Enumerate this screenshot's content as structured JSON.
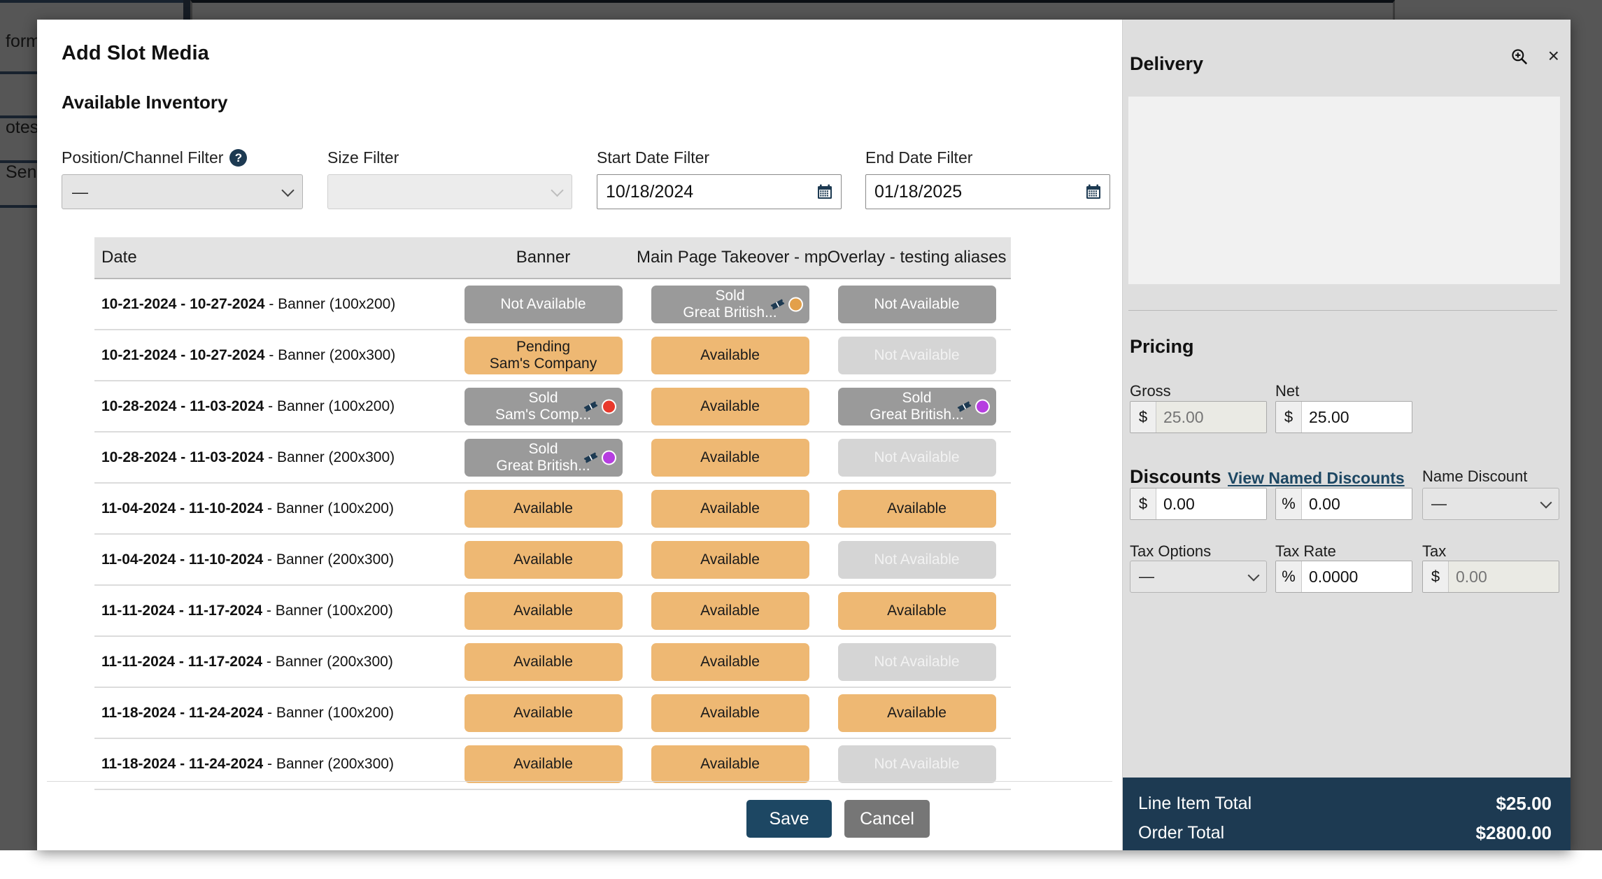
{
  "background": {
    "left_items": [
      "form",
      "otes",
      "Send"
    ]
  },
  "modal": {
    "title": "Add Slot Media",
    "section_title": "Available Inventory"
  },
  "filters": {
    "position_channel": {
      "label": "Position/Channel Filter",
      "help_icon": "question-mark-icon",
      "value": "—"
    },
    "size": {
      "label": "Size Filter",
      "value": ""
    },
    "start_date": {
      "label": "Start Date Filter",
      "value": "10/18/2024",
      "icon": "calendar-icon"
    },
    "end_date": {
      "label": "End Date Filter",
      "value": "01/18/2025",
      "icon": "calendar-icon"
    }
  },
  "inventory_table": {
    "columns": [
      "Date",
      "Banner",
      "Main Page Takeover - mp",
      "Overlay - testing aliases"
    ],
    "rows": [
      {
        "date_range": "10-21-2024 - 10-27-2024",
        "suffix": " - Banner (100x200)",
        "cells": [
          {
            "state": "notavail",
            "line1": "Not Available",
            "line2": ""
          },
          {
            "state": "sold",
            "line1": "Sold",
            "line2": "Great British...",
            "tag": true,
            "dot": "#e3a04a"
          },
          {
            "state": "notavail",
            "line1": "Not Available",
            "line2": ""
          }
        ]
      },
      {
        "date_range": "10-21-2024 - 10-27-2024",
        "suffix": " - Banner (200x300)",
        "cells": [
          {
            "state": "pending",
            "line1": "Pending",
            "line2": "Sam's Company"
          },
          {
            "state": "available",
            "line1": "Available",
            "line2": ""
          },
          {
            "state": "notavail-lt",
            "line1": "Not Available",
            "line2": ""
          }
        ]
      },
      {
        "date_range": "10-28-2024 - 11-03-2024",
        "suffix": " - Banner (100x200)",
        "cells": [
          {
            "state": "sold",
            "line1": "Sold",
            "line2": "Sam's Comp...",
            "tag": true,
            "dot": "#e8392c"
          },
          {
            "state": "available",
            "line1": "Available",
            "line2": ""
          },
          {
            "state": "sold",
            "line1": "Sold",
            "line2": "Great British...",
            "tag": true,
            "dot": "#b63ee0"
          }
        ]
      },
      {
        "date_range": "10-28-2024 - 11-03-2024",
        "suffix": " - Banner (200x300)",
        "cells": [
          {
            "state": "sold",
            "line1": "Sold",
            "line2": "Great British...",
            "tag": true,
            "dot": "#b63ee0"
          },
          {
            "state": "available",
            "line1": "Available",
            "line2": ""
          },
          {
            "state": "notavail-lt",
            "line1": "Not Available",
            "line2": ""
          }
        ]
      },
      {
        "date_range": "11-04-2024 - 11-10-2024",
        "suffix": " - Banner (100x200)",
        "cells": [
          {
            "state": "available",
            "line1": "Available",
            "line2": ""
          },
          {
            "state": "available",
            "line1": "Available",
            "line2": ""
          },
          {
            "state": "available",
            "line1": "Available",
            "line2": ""
          }
        ]
      },
      {
        "date_range": "11-04-2024 - 11-10-2024",
        "suffix": " - Banner (200x300)",
        "cells": [
          {
            "state": "available",
            "line1": "Available",
            "line2": ""
          },
          {
            "state": "available",
            "line1": "Available",
            "line2": ""
          },
          {
            "state": "notavail-lt",
            "line1": "Not Available",
            "line2": ""
          }
        ]
      },
      {
        "date_range": "11-11-2024 - 11-17-2024",
        "suffix": " - Banner (100x200)",
        "cells": [
          {
            "state": "available",
            "line1": "Available",
            "line2": ""
          },
          {
            "state": "available",
            "line1": "Available",
            "line2": ""
          },
          {
            "state": "available",
            "line1": "Available",
            "line2": ""
          }
        ]
      },
      {
        "date_range": "11-11-2024 - 11-17-2024",
        "suffix": " - Banner (200x300)",
        "cells": [
          {
            "state": "available",
            "line1": "Available",
            "line2": ""
          },
          {
            "state": "available",
            "line1": "Available",
            "line2": ""
          },
          {
            "state": "notavail-lt",
            "line1": "Not Available",
            "line2": ""
          }
        ]
      },
      {
        "date_range": "11-18-2024 - 11-24-2024",
        "suffix": " - Banner (100x200)",
        "cells": [
          {
            "state": "available",
            "line1": "Available",
            "line2": ""
          },
          {
            "state": "available",
            "line1": "Available",
            "line2": ""
          },
          {
            "state": "available",
            "line1": "Available",
            "line2": ""
          }
        ]
      },
      {
        "date_range": "11-18-2024 - 11-24-2024",
        "suffix": " - Banner (200x300)",
        "cells": [
          {
            "state": "available",
            "line1": "Available",
            "line2": ""
          },
          {
            "state": "available",
            "line1": "Available",
            "line2": ""
          },
          {
            "state": "notavail-lt",
            "line1": "Not Available",
            "line2": ""
          }
        ]
      }
    ]
  },
  "footer": {
    "save_label": "Save",
    "cancel_label": "Cancel"
  },
  "right_panel": {
    "delivery_title": "Delivery",
    "zoom_icon": "magnifier-plus-icon",
    "close_icon": "close-icon",
    "pricing_title": "Pricing",
    "gross": {
      "label": "Gross",
      "prefix": "$",
      "value": "",
      "placeholder": "25.00",
      "readonly": true
    },
    "net": {
      "label": "Net",
      "prefix": "$",
      "value": "25.00",
      "placeholder": ""
    },
    "discounts_title": "Discounts",
    "view_named_discounts": "View Named Discounts",
    "discount_amount": {
      "prefix": "$",
      "value": "0.00"
    },
    "discount_percent": {
      "prefix": "%",
      "value": "0.00"
    },
    "name_discount": {
      "label": "Name Discount",
      "value": "—"
    },
    "tax_options": {
      "label": "Tax Options",
      "value": "—"
    },
    "tax_rate": {
      "label": "Tax Rate",
      "prefix": "%",
      "value": "0.0000"
    },
    "tax": {
      "label": "Tax",
      "prefix": "$",
      "value": "",
      "placeholder": "0.00",
      "readonly": true
    },
    "totals": [
      {
        "label": "Line Item Total",
        "value": "$25.00"
      },
      {
        "label": "Order Total",
        "value": "$2800.00"
      }
    ]
  },
  "colors": {
    "accent_navy": "#1d3a52",
    "available": "#eeb873",
    "unavailable": "#9a9a9a",
    "unavailable_light": "#d5d5d5"
  }
}
